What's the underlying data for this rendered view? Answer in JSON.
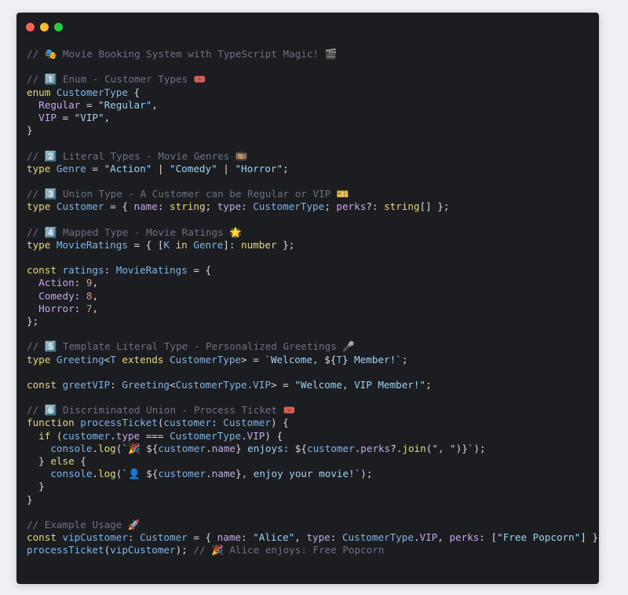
{
  "window": {
    "controls": [
      "close",
      "minimize",
      "maximize"
    ],
    "language": "TypeScript"
  },
  "code_lines": [
    [
      [
        "c",
        "// 🎭 Movie Booking System with TypeScript Magic! 🎬"
      ]
    ],
    [],
    [
      [
        "c",
        "// 1️⃣ Enum - Customer Types 🎟️"
      ]
    ],
    [
      [
        "k",
        "enum "
      ],
      [
        "t",
        "CustomerType"
      ],
      [
        "o",
        " {"
      ]
    ],
    [
      [
        "o",
        "  "
      ],
      [
        "p",
        "Regular"
      ],
      [
        "o",
        " = "
      ],
      [
        "s",
        "\"Regular\""
      ],
      [
        "o",
        ","
      ]
    ],
    [
      [
        "o",
        "  "
      ],
      [
        "p",
        "VIP"
      ],
      [
        "o",
        " = "
      ],
      [
        "s",
        "\"VIP\""
      ],
      [
        "o",
        ","
      ]
    ],
    [
      [
        "o",
        "}"
      ]
    ],
    [],
    [
      [
        "c",
        "// 2️⃣ Literal Types - Movie Genres 🎞️"
      ]
    ],
    [
      [
        "k",
        "type "
      ],
      [
        "t",
        "Genre"
      ],
      [
        "o",
        " = "
      ],
      [
        "s",
        "\"Action\""
      ],
      [
        "o",
        " | "
      ],
      [
        "s",
        "\"Comedy\""
      ],
      [
        "o",
        " | "
      ],
      [
        "s",
        "\"Horror\""
      ],
      [
        "o",
        ";"
      ]
    ],
    [],
    [
      [
        "c",
        "// 3️⃣ Union Type - A Customer can be Regular or VIP 🎫"
      ]
    ],
    [
      [
        "k",
        "type "
      ],
      [
        "t",
        "Customer"
      ],
      [
        "o",
        " = { "
      ],
      [
        "p",
        "name"
      ],
      [
        "o",
        ": "
      ],
      [
        "k",
        "string"
      ],
      [
        "o",
        "; "
      ],
      [
        "p",
        "type"
      ],
      [
        "o",
        ": "
      ],
      [
        "t",
        "CustomerType"
      ],
      [
        "o",
        "; "
      ],
      [
        "p",
        "perks"
      ],
      [
        "o",
        "?: "
      ],
      [
        "k",
        "string"
      ],
      [
        "o",
        "[] };"
      ]
    ],
    [],
    [
      [
        "c",
        "// 4️⃣ Mapped Type - Movie Ratings 🌟"
      ]
    ],
    [
      [
        "k",
        "type "
      ],
      [
        "t",
        "MovieRatings"
      ],
      [
        "o",
        " = { ["
      ],
      [
        "t",
        "K"
      ],
      [
        "k",
        " in "
      ],
      [
        "t",
        "Genre"
      ],
      [
        "o",
        "]: "
      ],
      [
        "k",
        "number"
      ],
      [
        "o",
        " };"
      ]
    ],
    [],
    [
      [
        "k",
        "const "
      ],
      [
        "t",
        "ratings"
      ],
      [
        "o",
        ": "
      ],
      [
        "t",
        "MovieRatings"
      ],
      [
        "o",
        " = {"
      ]
    ],
    [
      [
        "o",
        "  "
      ],
      [
        "p",
        "Action"
      ],
      [
        "o",
        ": "
      ],
      [
        "n",
        "9"
      ],
      [
        "o",
        ","
      ]
    ],
    [
      [
        "o",
        "  "
      ],
      [
        "p",
        "Comedy"
      ],
      [
        "o",
        ": "
      ],
      [
        "n",
        "8"
      ],
      [
        "o",
        ","
      ]
    ],
    [
      [
        "o",
        "  "
      ],
      [
        "p",
        "Horror"
      ],
      [
        "o",
        ": "
      ],
      [
        "n",
        "7"
      ],
      [
        "o",
        ","
      ]
    ],
    [
      [
        "o",
        "};"
      ]
    ],
    [],
    [
      [
        "c",
        "// 5️⃣ Template Literal Type - Personalized Greetings 🎤"
      ]
    ],
    [
      [
        "k",
        "type "
      ],
      [
        "t",
        "Greeting"
      ],
      [
        "o",
        "<"
      ],
      [
        "t",
        "T"
      ],
      [
        "k",
        " extends "
      ],
      [
        "t",
        "CustomerType"
      ],
      [
        "o",
        "> = "
      ],
      [
        "s",
        "`Welcome, "
      ],
      [
        "o",
        "${"
      ],
      [
        "t",
        "T"
      ],
      [
        "o",
        "}"
      ],
      [
        "s",
        " Member!`"
      ],
      [
        "o",
        ";"
      ]
    ],
    [],
    [
      [
        "k",
        "const "
      ],
      [
        "t",
        "greetVIP"
      ],
      [
        "o",
        ": "
      ],
      [
        "t",
        "Greeting"
      ],
      [
        "o",
        "<"
      ],
      [
        "t",
        "CustomerType.VIP"
      ],
      [
        "o",
        "> = "
      ],
      [
        "s",
        "\"Welcome, VIP Member!\""
      ],
      [
        "o",
        ";"
      ]
    ],
    [],
    [
      [
        "c",
        "// 6️⃣ Discriminated Union - Process Ticket 🎟️"
      ]
    ],
    [
      [
        "k",
        "function "
      ],
      [
        "t",
        "processTicket"
      ],
      [
        "o",
        "("
      ],
      [
        "t",
        "customer"
      ],
      [
        "o",
        ": "
      ],
      [
        "t",
        "Customer"
      ],
      [
        "o",
        ") {"
      ]
    ],
    [
      [
        "o",
        "  "
      ],
      [
        "k",
        "if"
      ],
      [
        "o",
        " ("
      ],
      [
        "t",
        "customer"
      ],
      [
        "o",
        "."
      ],
      [
        "p",
        "type"
      ],
      [
        "o",
        " === "
      ],
      [
        "t",
        "CustomerType"
      ],
      [
        "o",
        "."
      ],
      [
        "p",
        "VIP"
      ],
      [
        "o",
        ") {"
      ]
    ],
    [
      [
        "o",
        "    "
      ],
      [
        "t",
        "console"
      ],
      [
        "o",
        "."
      ],
      [
        "k",
        "log"
      ],
      [
        "o",
        "("
      ],
      [
        "s",
        "`🎉 "
      ],
      [
        "o",
        "${"
      ],
      [
        "t",
        "customer"
      ],
      [
        "o",
        "."
      ],
      [
        "p",
        "name"
      ],
      [
        "o",
        "}"
      ],
      [
        "s",
        " enjoys: "
      ],
      [
        "o",
        "${"
      ],
      [
        "t",
        "customer"
      ],
      [
        "o",
        "."
      ],
      [
        "p",
        "perks"
      ],
      [
        "o",
        "?."
      ],
      [
        "k",
        "join"
      ],
      [
        "o",
        "("
      ],
      [
        "s",
        "\", \""
      ],
      [
        "o",
        ")}"
      ],
      [
        "s",
        "`"
      ],
      [
        "o",
        ");"
      ]
    ],
    [
      [
        "o",
        "  } "
      ],
      [
        "k",
        "else"
      ],
      [
        "o",
        " {"
      ]
    ],
    [
      [
        "o",
        "    "
      ],
      [
        "t",
        "console"
      ],
      [
        "o",
        "."
      ],
      [
        "k",
        "log"
      ],
      [
        "o",
        "("
      ],
      [
        "s",
        "`👤 "
      ],
      [
        "o",
        "${"
      ],
      [
        "t",
        "customer"
      ],
      [
        "o",
        "."
      ],
      [
        "p",
        "name"
      ],
      [
        "o",
        "}"
      ],
      [
        "s",
        ", enjoy your movie!`"
      ],
      [
        "o",
        ");"
      ]
    ],
    [
      [
        "o",
        "  }"
      ]
    ],
    [
      [
        "o",
        "}"
      ]
    ],
    [],
    [
      [
        "c",
        "// Example Usage 🚀"
      ]
    ],
    [
      [
        "k",
        "const "
      ],
      [
        "t",
        "vipCustomer"
      ],
      [
        "o",
        ": "
      ],
      [
        "t",
        "Customer"
      ],
      [
        "o",
        " = { "
      ],
      [
        "p",
        "name"
      ],
      [
        "o",
        ": "
      ],
      [
        "s",
        "\"Alice\""
      ],
      [
        "o",
        ", "
      ],
      [
        "p",
        "type"
      ],
      [
        "o",
        ": "
      ],
      [
        "t",
        "CustomerType"
      ],
      [
        "o",
        "."
      ],
      [
        "p",
        "VIP"
      ],
      [
        "o",
        ", "
      ],
      [
        "p",
        "perks"
      ],
      [
        "o",
        ": ["
      ],
      [
        "s",
        "\"Free Popcorn\""
      ],
      [
        "o",
        "] };"
      ]
    ],
    [
      [
        "t",
        "processTicket"
      ],
      [
        "o",
        "("
      ],
      [
        "t",
        "vipCustomer"
      ],
      [
        "o",
        "); "
      ],
      [
        "c",
        "// 🎉 Alice enjoys: Free Popcorn"
      ]
    ]
  ]
}
